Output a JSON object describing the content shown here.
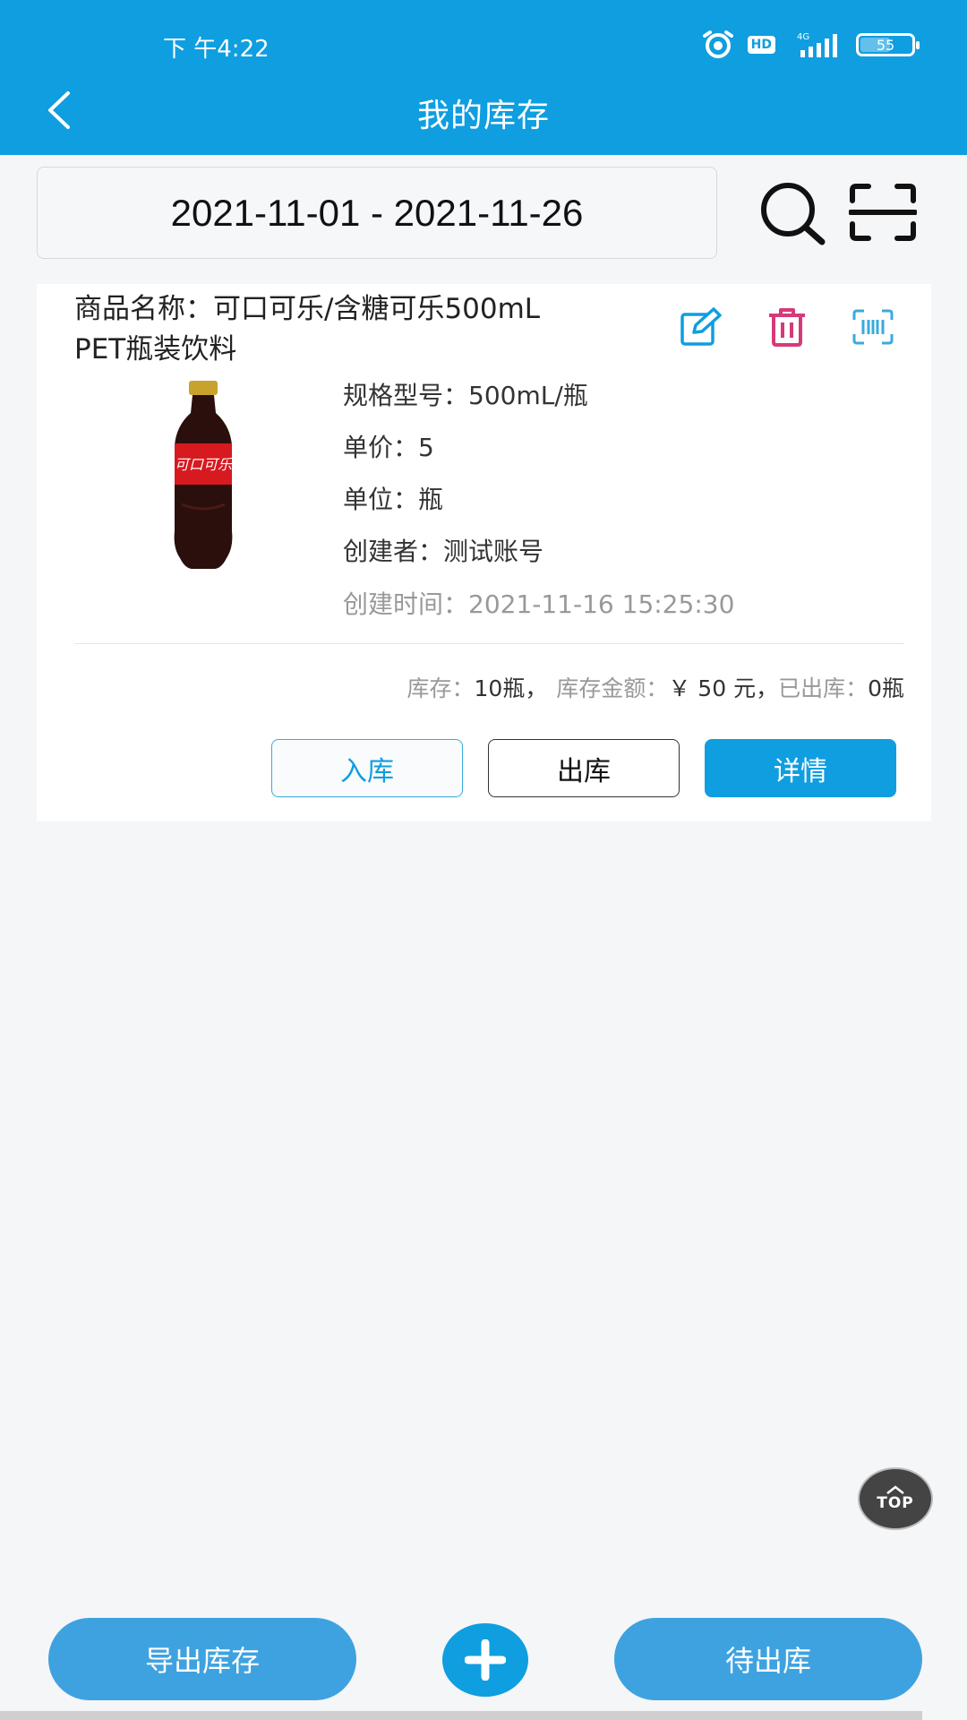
{
  "status_bar": {
    "time": "下 午4:22",
    "network": "4G",
    "hd": "HD",
    "battery": "55"
  },
  "header": {
    "title": "我的库存"
  },
  "filter": {
    "date_range": "2021-11-01 - 2021-11-26"
  },
  "product": {
    "name": "商品名称：可口可乐/含糖可乐500mL PET瓶装饮料",
    "spec": "规格型号：500mL/瓶",
    "unit_price": "单价：5",
    "unit": "单位：瓶",
    "creator": "创建者：测试账号",
    "created_time": "创建时间：2021-11-16 15:25:30",
    "stock_label": "库存：",
    "stock_value": "10瓶，",
    "amount_label": "库存金额：",
    "amount_value": "￥ 50 元，",
    "shipped_label": "已出库：",
    "shipped_value": "0瓶",
    "btn_in": "入库",
    "btn_out": "出库",
    "btn_detail": "详情",
    "bottle_label": "可口可乐"
  },
  "top_button": "TOP",
  "bottom": {
    "export": "导出库存",
    "pending": "待出库"
  },
  "colors": {
    "primary": "#0f9ee0",
    "delete": "#d63a7a"
  }
}
